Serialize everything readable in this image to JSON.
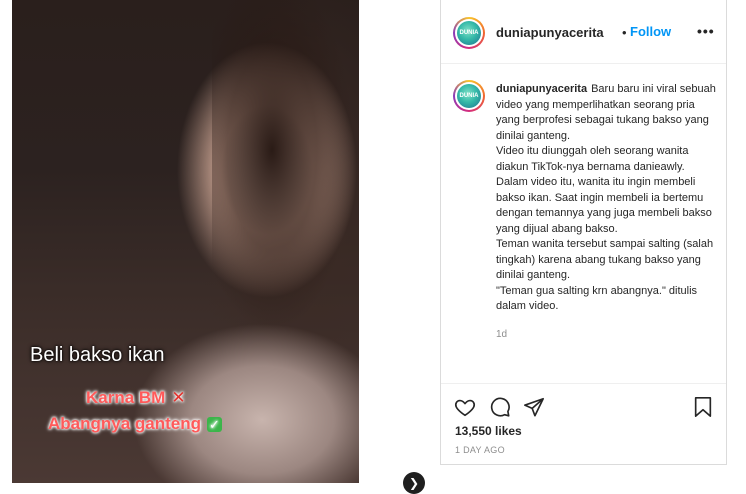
{
  "post": {
    "username": "duniapunyacerita",
    "follow_label": "Follow",
    "separator": "•",
    "more_label": "•••",
    "avatar_text": "DUNIA"
  },
  "media": {
    "overlay_text": "Beli bakso ikan",
    "sticker1_text": "Karna BM",
    "sticker1_mark": "✕",
    "sticker2_text": "Abangnya ganteng",
    "sticker2_mark": "✓",
    "next_label": "❯"
  },
  "caption": {
    "username": "duniapunyacerita",
    "lines": [
      "Baru baru ini viral sebuah video yang memperlihatkan seorang pria yang berprofesi sebagai tukang bakso yang dinilai ganteng.",
      "Video itu diunggah oleh seorang wanita diakun TikTok-nya bernama danieawly.",
      "Dalam video itu, wanita itu ingin membeli bakso ikan. Saat ingin membeli ia bertemu dengan temannya yang juga membeli bakso yang dijual abang bakso.",
      "Teman wanita tersebut sampai salting (salah tingkah) karena abang tukang bakso yang dinilai ganteng.",
      "\"Teman gua salting krn abangnya.\" ditulis dalam video."
    ],
    "timestamp": "1d"
  },
  "actions": {
    "likes": "13,550 likes",
    "time_ago": "1 DAY AGO",
    "icons": [
      "heart-icon",
      "comment-icon",
      "share-icon",
      "save-icon"
    ]
  }
}
